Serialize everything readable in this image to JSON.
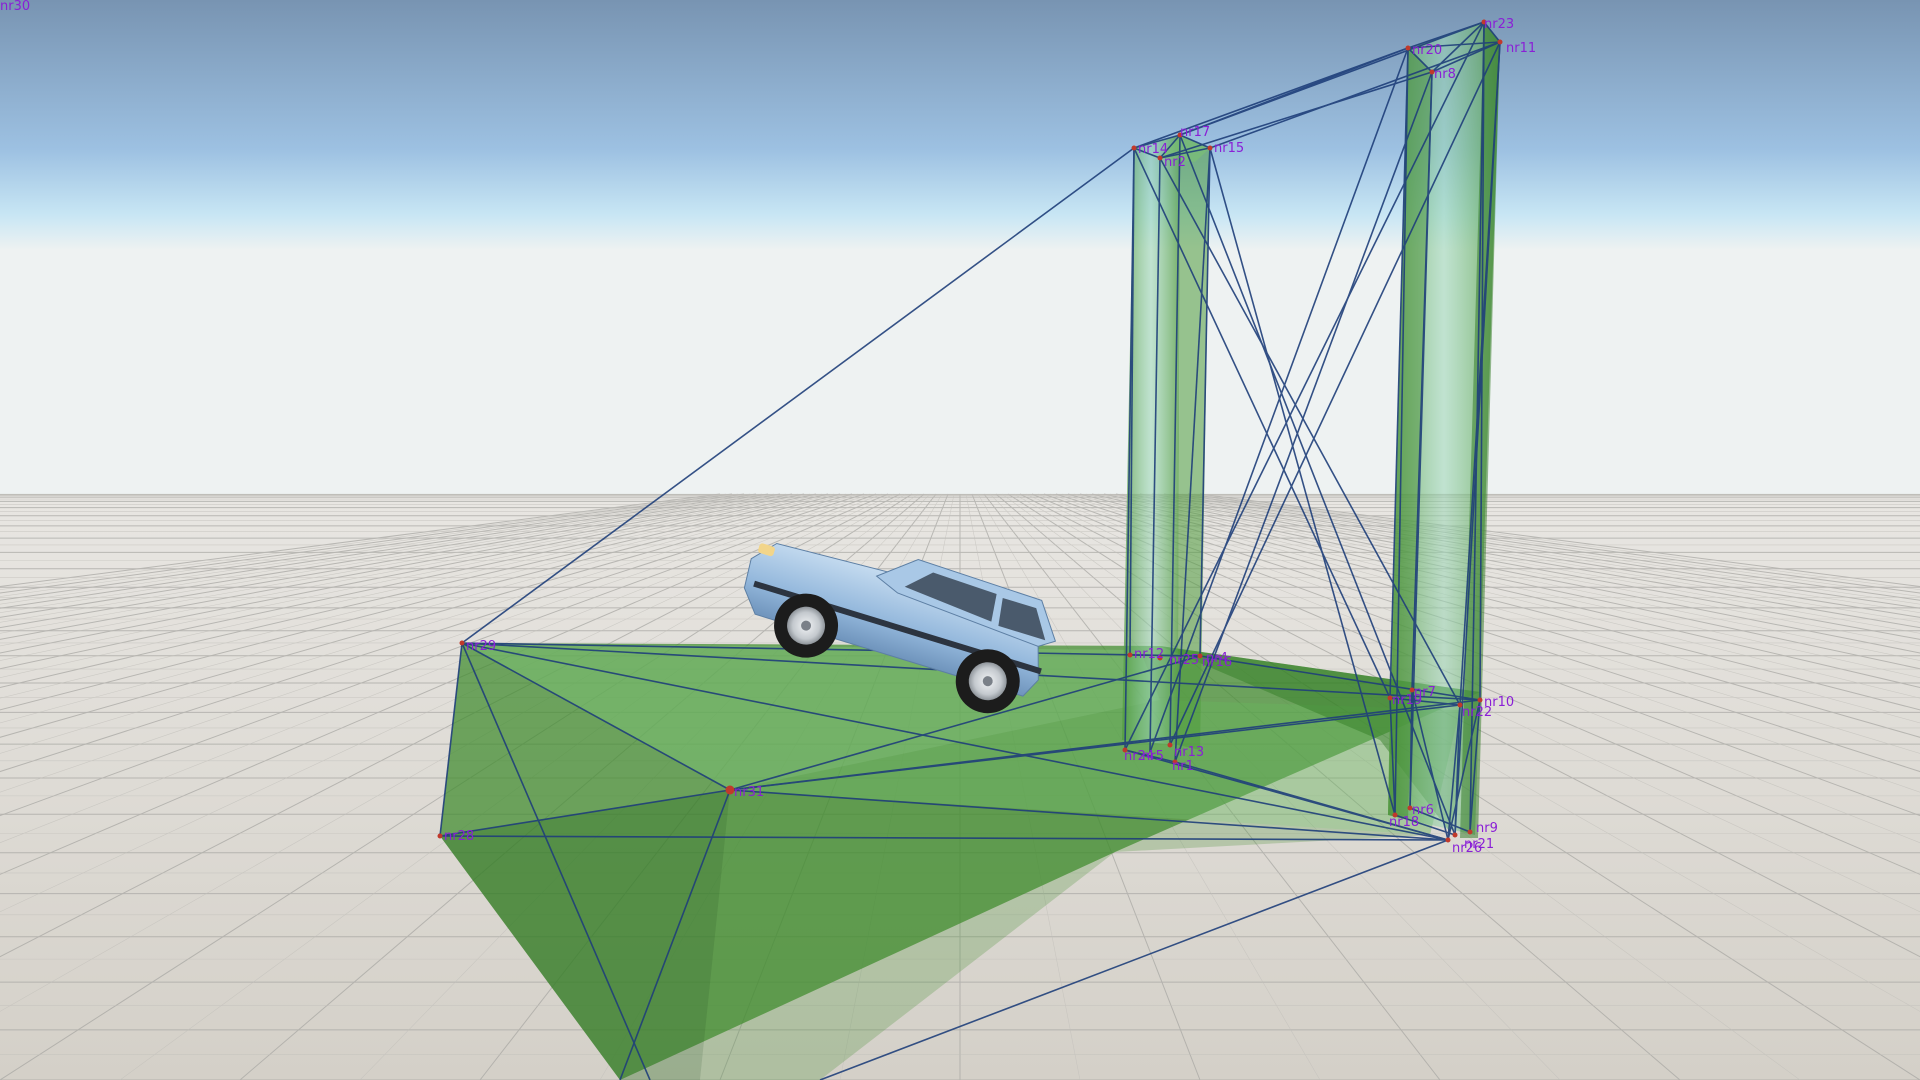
{
  "colors": {
    "sky_top": "#7a96b4",
    "sky_mid": "#a6c8e6",
    "sky_horizon": "#e6f0f4",
    "ground": "#d9d6cf",
    "grid_line": "#a9a8a4",
    "mesh_fill": "#3f8a2c",
    "mesh_fill_light": "#8fd08a",
    "beam": "#1f3f7a",
    "node_dot": "#c0392b",
    "label": "#8a1fd6",
    "car_body": "#9cbfe0",
    "car_dark": "#2c3440",
    "tire": "#1c1c1c",
    "rim": "#d4d8dc"
  },
  "corner_label": "nr30",
  "node_labels": [
    "nr23",
    "nr20",
    "nr11",
    "nr8",
    "nr17",
    "nr14",
    "nr15",
    "nr2",
    "nr29",
    "nr31",
    "nr28",
    "nr12",
    "nr25",
    "nr4",
    "nr16",
    "nr7",
    "nr19",
    "nr10",
    "nr22",
    "nr13",
    "nr24",
    "nr5",
    "nr1",
    "nr18",
    "nr6",
    "nr9",
    "nr21",
    "nr26"
  ],
  "icons": {
    "vehicle": "car-icon"
  }
}
